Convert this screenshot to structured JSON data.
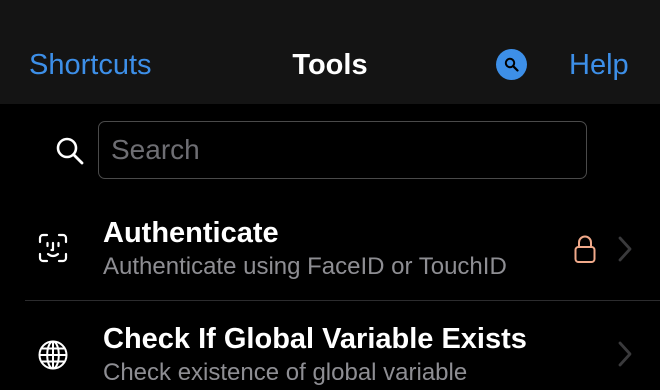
{
  "nav": {
    "back_label": "Shortcuts",
    "title": "Tools",
    "help_label": "Help",
    "search_button_icon": "magnifier-icon"
  },
  "search": {
    "placeholder": "Search",
    "value": ""
  },
  "actions": [
    {
      "title": "Authenticate",
      "subtitle": "Authenticate using FaceID or TouchID",
      "icon": "faceid-icon",
      "locked": true
    },
    {
      "title": "Check If Global Variable Exists",
      "subtitle": "Check existence of global variable",
      "icon": "globe-icon",
      "locked": false
    }
  ],
  "colors": {
    "accent": "#3d8fe8",
    "lock": "#f0a98a",
    "secondary_text": "#8e8e93",
    "nav_background": "#141414",
    "background": "#000000"
  }
}
